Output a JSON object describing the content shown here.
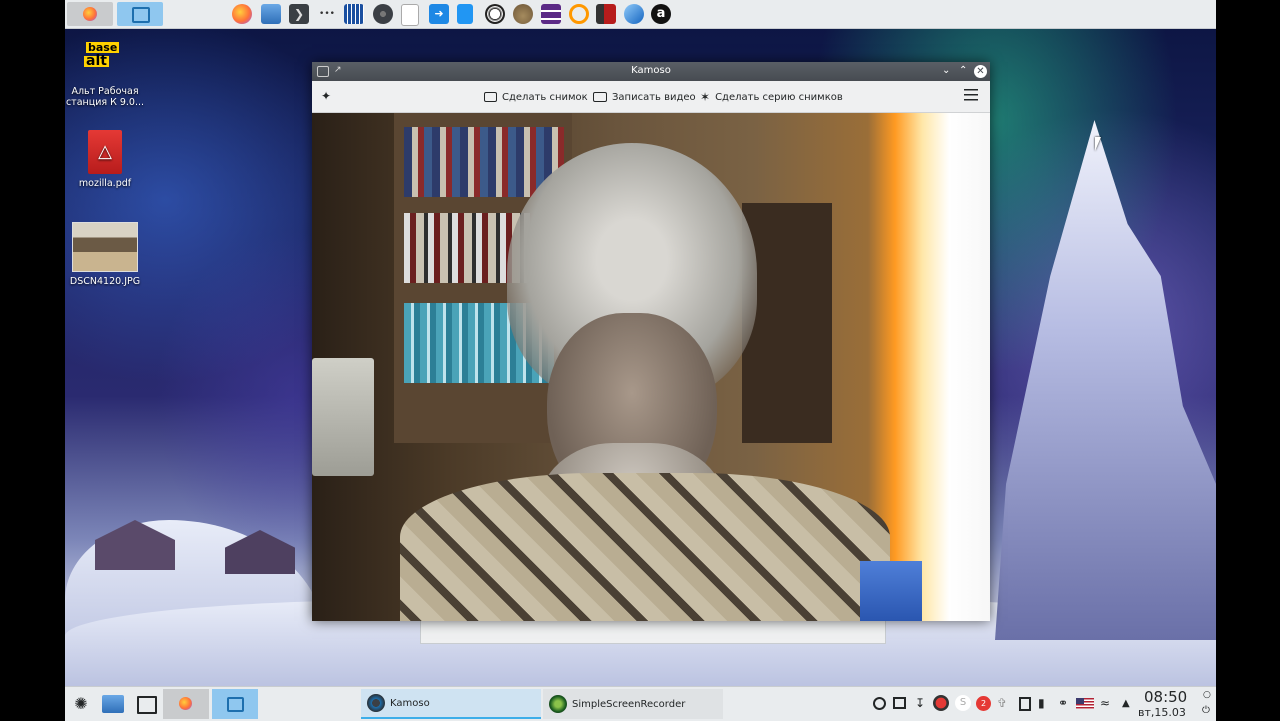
{
  "desktop": {
    "icons": [
      {
        "label": "Альт Рабочая станция К 9.0...",
        "icon": "basealt-logo"
      },
      {
        "label": "mozilla.pdf",
        "icon": "pdf-file-icon"
      },
      {
        "label": "DSCN4120.JPG",
        "icon": "image-thumbnail"
      }
    ],
    "logo_text": {
      "line1": "base",
      "line2": "alt"
    }
  },
  "top_panel": {
    "launchers": [
      "firefox-icon",
      "file-manager-icon",
      "terminal-icon",
      "more-icon",
      "archive-icon",
      "disc-icon",
      "text-editor-icon",
      "share-icon",
      "document-icon",
      "soccer-icon",
      "gimp-icon",
      "audio-icon",
      "headphones-icon",
      "video-icon",
      "network-icon",
      "account-icon"
    ],
    "more_label": "•••"
  },
  "window": {
    "title": "Kamoso",
    "toolbar": {
      "snapshot": "Сделать снимок",
      "record": "Записать видео",
      "burst": "Сделать серию снимков"
    }
  },
  "taskbar": {
    "tasks": [
      {
        "label": "Kamoso",
        "active": true
      },
      {
        "label": "SimpleScreenRecorder",
        "active": false
      }
    ],
    "clock": {
      "time": "08:50",
      "date": "вт,15.03"
    },
    "badge_count": "2",
    "colors": {
      "accent": "#3daee9",
      "active_task": "#cfe3f2",
      "panel": "#e9ecee"
    }
  }
}
